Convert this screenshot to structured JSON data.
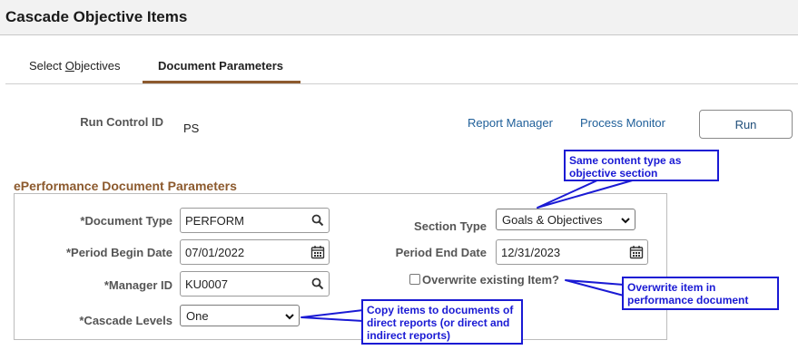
{
  "page": {
    "title": "Cascade Objective Items"
  },
  "tabs": [
    {
      "label_prefix": "Select ",
      "label_accel": "O",
      "label_suffix": "bjectives",
      "active": false
    },
    {
      "label": "Document Parameters",
      "active": true
    }
  ],
  "run_control": {
    "label": "Run Control ID",
    "value": "PS"
  },
  "links": {
    "report_manager": "Report Manager",
    "process_monitor": "Process Monitor"
  },
  "run_button": {
    "label": "Run"
  },
  "section": {
    "title": "ePerformance Document Parameters"
  },
  "fields": {
    "document_type": {
      "label": "*Document Type",
      "value": "PERFORM",
      "icon": "search-icon"
    },
    "period_begin": {
      "label": "*Period Begin Date",
      "value": "07/01/2022",
      "icon": "calendar-icon"
    },
    "manager_id": {
      "label": "*Manager ID",
      "value": "KU0007",
      "icon": "search-icon"
    },
    "cascade_levels": {
      "label": "*Cascade Levels",
      "value": "One"
    },
    "section_type": {
      "label": "Section Type",
      "value": "Goals & Objectives"
    },
    "period_end": {
      "label": "Period End Date",
      "value": "12/31/2023",
      "icon": "calendar-icon"
    },
    "overwrite": {
      "label": "Overwrite existing Item?",
      "checked": false
    }
  },
  "callouts": {
    "section_type_note": "Same content type as objective section",
    "overwrite_note": "Overwrite item in performance document",
    "cascade_note": "Copy items to documents of direct reports (or direct and indirect reports)"
  },
  "colors": {
    "accent": "#8c5a2e",
    "link": "#1f5f99",
    "callout": "#1a1ad4"
  }
}
